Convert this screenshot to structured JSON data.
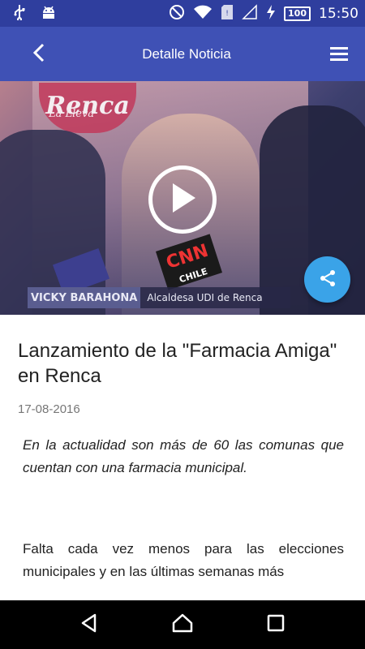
{
  "status_bar": {
    "time": "15:50",
    "battery": "100",
    "left_icons": [
      "usb-icon",
      "android-icon"
    ],
    "right_icons": [
      "do-not-disturb-icon",
      "wifi-icon",
      "sim-card-icon",
      "signal-icon",
      "charging-icon"
    ]
  },
  "app_bar": {
    "title": "Detalle Noticia",
    "back_icon": "back-chevron-icon",
    "menu_icon": "hamburger-menu-icon"
  },
  "video": {
    "logo_text": "Renca",
    "logo_subtext": "La Lleva",
    "mic_label": "CNN",
    "mic_sublabel": "CHILE",
    "lower_third_name": "VICKY BARAHONA",
    "lower_third_role": "Alcaldesa UDI de Renca",
    "play_icon": "play-circle-icon"
  },
  "share_icon": "share-icon",
  "article": {
    "title": "Lanzamiento de la \"Farmacia Amiga\" en Renca",
    "date": "17-08-2016",
    "lead": "En la actualidad son más de 60 las comunas que cuentan con una farmacia municipal.",
    "body": "Falta cada vez menos para las elecciones municipales y en las últimas semanas más"
  },
  "nav": {
    "back_icon": "nav-back-icon",
    "home_icon": "nav-home-icon",
    "recents_icon": "nav-recents-icon"
  },
  "colors": {
    "status_bar": "#2f3e9e",
    "app_bar": "#3f51b5",
    "share_fab": "#3aa3e8",
    "nav_bar": "#000000"
  }
}
